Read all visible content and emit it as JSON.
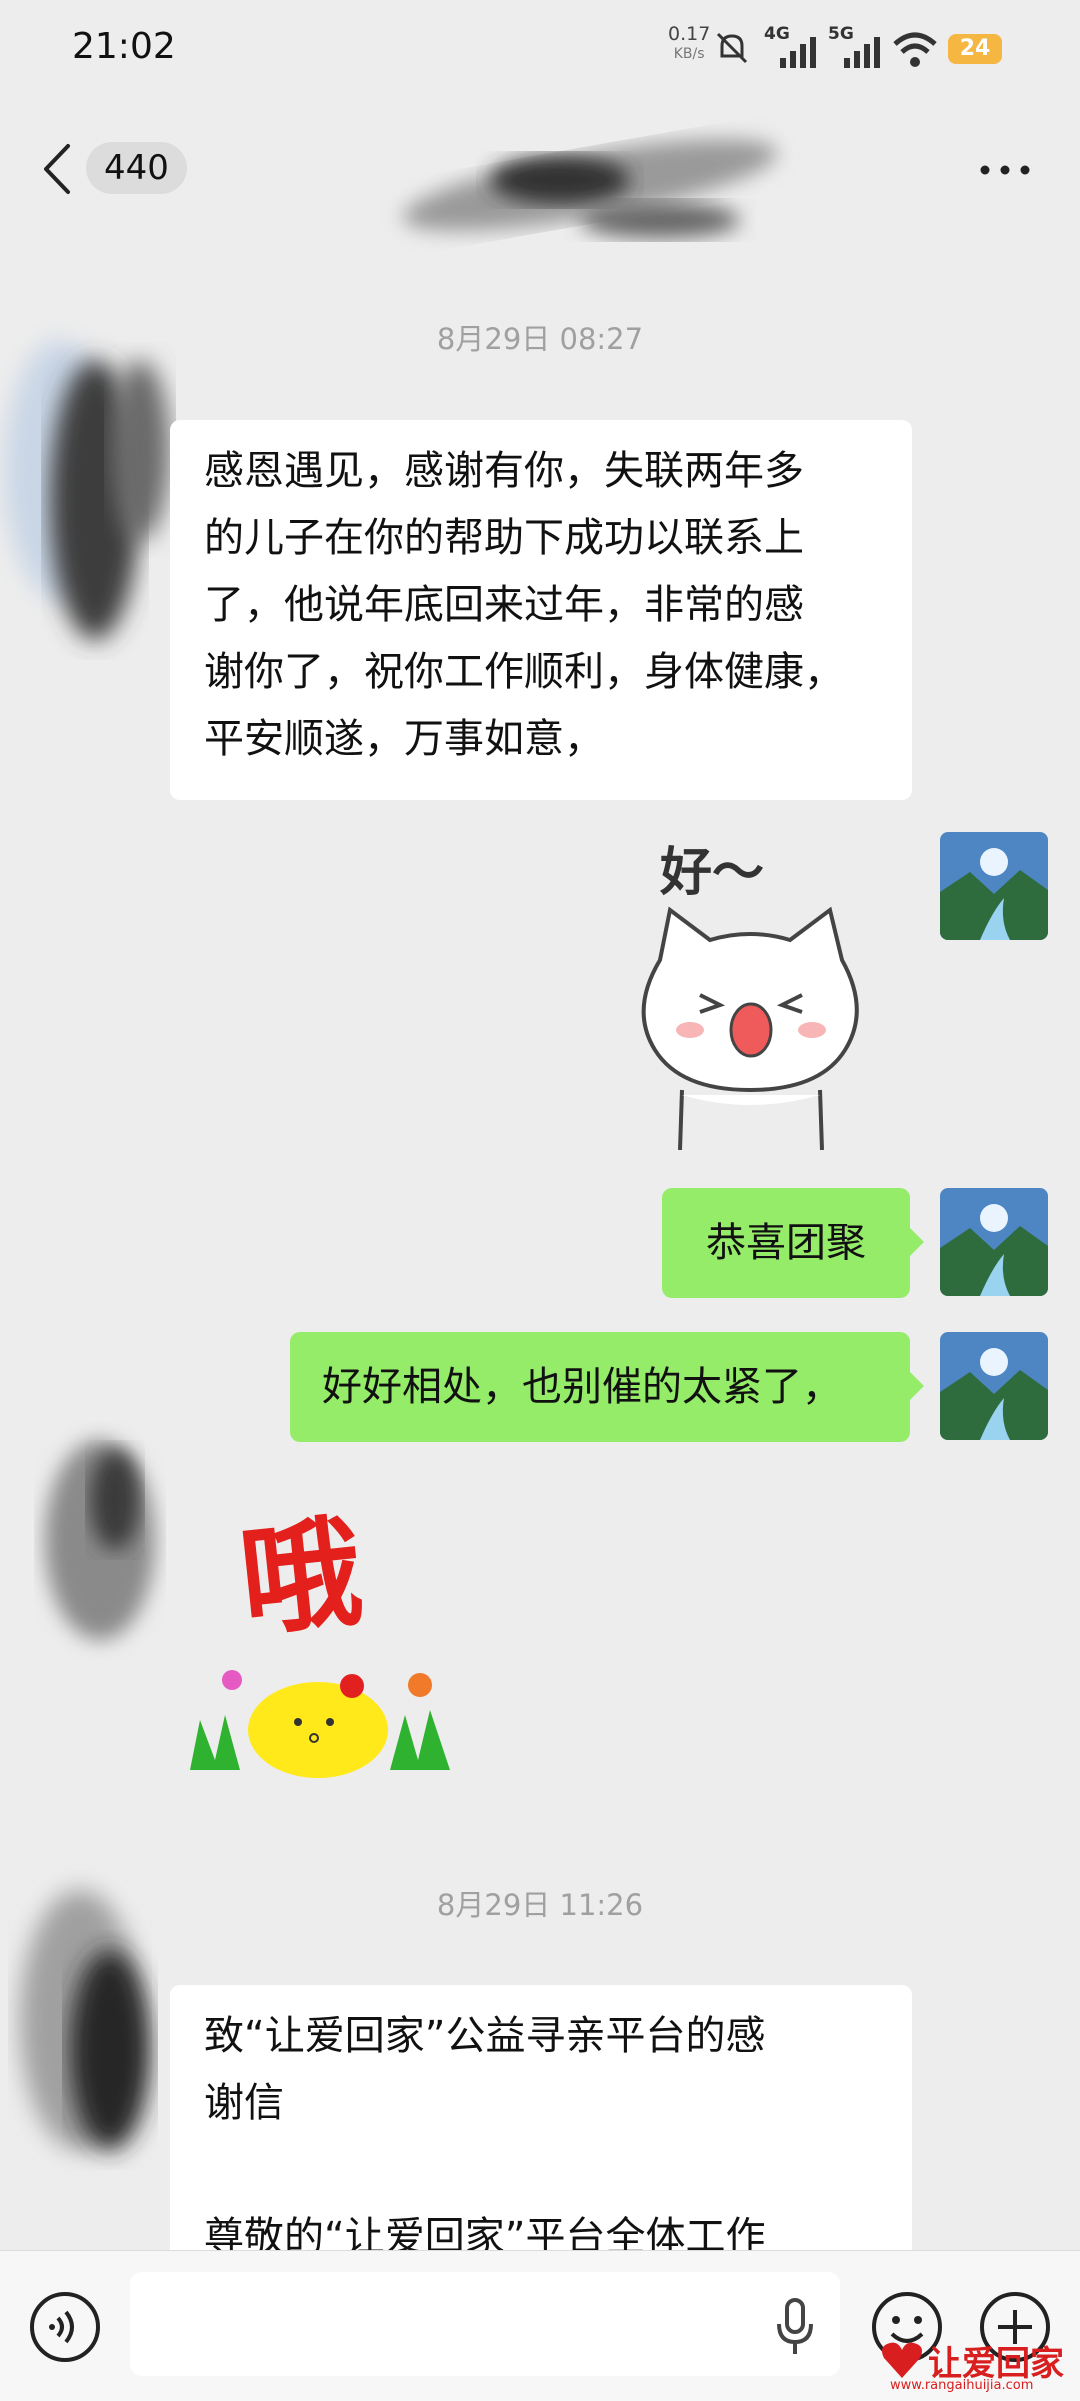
{
  "status_bar": {
    "time": "21:02",
    "net_speed": "0.17",
    "net_speed_unit": "KB/s",
    "signal_1": "4G",
    "signal_2": "5G",
    "battery": "24"
  },
  "header": {
    "unread_count": "440"
  },
  "messages": {
    "ts1": "8月29日 08:27",
    "msg1_lines": [
      "感恩遇见，感谢有你，失联两年多",
      "的儿子在你的帮助下成功以联系上",
      "了，他说年底回来过年，非常的感",
      "谢你了，祝你工作顺利，身体健康，",
      "平安顺遂，万事如意，"
    ],
    "sticker1_text": "好～",
    "msg2": "恭喜团聚",
    "msg3": "好好相处，也别催的太紧了，",
    "sticker2_text": "哦",
    "ts2": "8月29日 11:26",
    "msg4_lines": [
      "致“让爱回家”公益寻亲平台的感",
      "谢信",
      "",
      "尊敬的“让爱回家”平台全体工作"
    ]
  },
  "watermark": {
    "brand": "让爱回家",
    "url": "www.rangaihuijia.com"
  },
  "colors": {
    "bubble_green": "#95ec69",
    "background": "#ededed"
  }
}
